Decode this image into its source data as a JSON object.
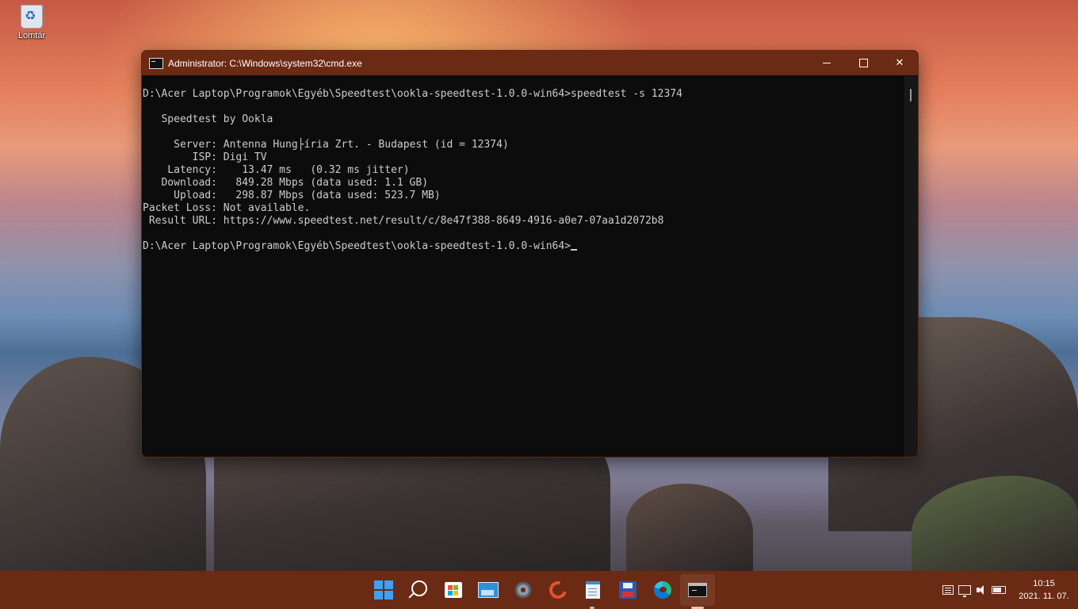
{
  "desktop": {
    "icons": [
      {
        "label": "Lomtár",
        "icon": "recycle-bin-icon"
      }
    ]
  },
  "window": {
    "title": "Administrator: C:\\Windows\\system32\\cmd.exe",
    "controls": {
      "minimize": "minimize",
      "maximize": "maximize",
      "close": "✕"
    },
    "console_lines": [
      "D:\\Acer Laptop\\Programok\\Egyéb\\Speedtest\\ookla-speedtest-1.0.0-win64>speedtest -s 12374",
      "",
      "   Speedtest by Ookla",
      "",
      "     Server: Antenna Hung├íria Zrt. - Budapest (id = 12374)",
      "        ISP: Digi TV",
      "    Latency:    13.47 ms   (0.32 ms jitter)",
      "   Download:   849.28 Mbps (data used: 1.1 GB)",
      "     Upload:   298.87 Mbps (data used: 523.7 MB)",
      "Packet Loss: Not available.",
      " Result URL: https://www.speedtest.net/result/c/8e47f388-8649-4916-a0e7-07aa1d2072b8",
      "",
      "D:\\Acer Laptop\\Programok\\Egyéb\\Speedtest\\ookla-speedtest-1.0.0-win64>"
    ]
  },
  "taskbar": {
    "apps": [
      {
        "name": "start-button",
        "icon": "windows-logo-icon"
      },
      {
        "name": "search-button",
        "icon": "search-icon"
      },
      {
        "name": "microsoft-store",
        "icon": "store-icon"
      },
      {
        "name": "photos-app",
        "icon": "photos-icon"
      },
      {
        "name": "settings-app",
        "icon": "gear-icon"
      },
      {
        "name": "ccleaner-app",
        "icon": "ccleaner-icon"
      },
      {
        "name": "notepad-app",
        "icon": "notepad-icon"
      },
      {
        "name": "save-app",
        "icon": "floppy-icon"
      },
      {
        "name": "edge-browser",
        "icon": "edge-icon"
      },
      {
        "name": "command-prompt",
        "icon": "cmd-icon"
      }
    ],
    "clock": {
      "time": "10:15",
      "date": "2021. 11. 07."
    }
  },
  "colors": {
    "titlebar": "#6b2a14",
    "taskbar": "#6b2a14",
    "console_bg": "#0c0c0c",
    "console_text": "#cccccc"
  }
}
